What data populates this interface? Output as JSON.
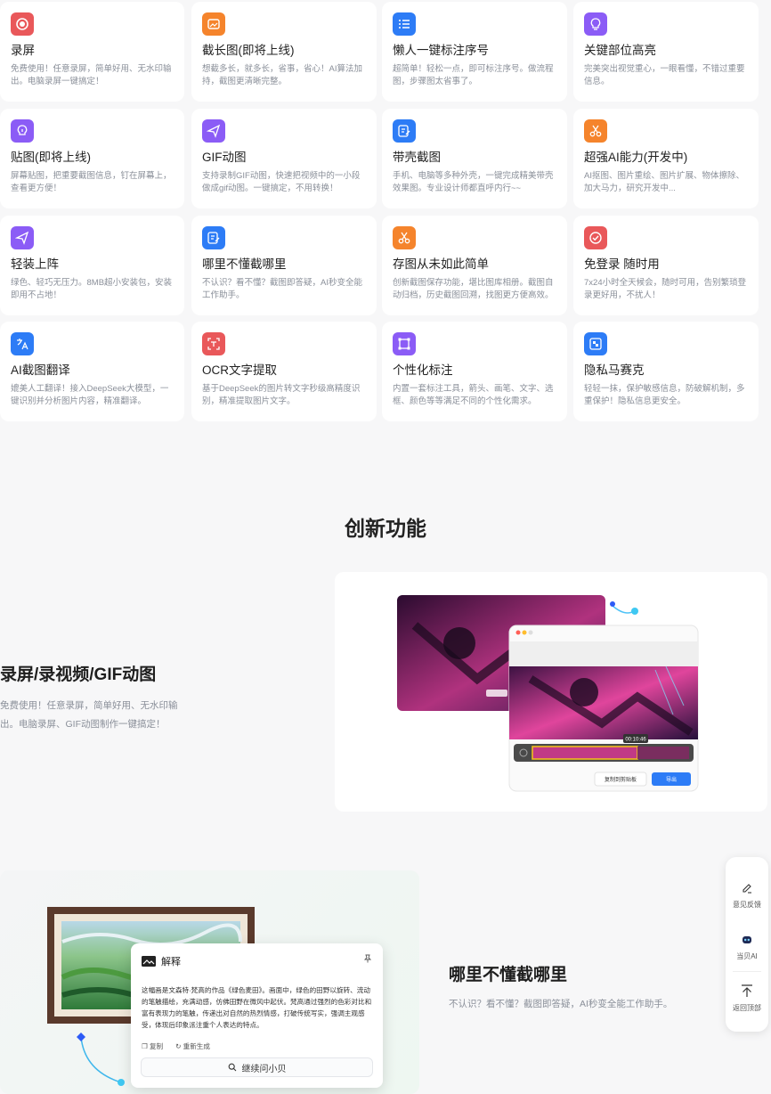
{
  "features": [
    {
      "title": "录屏",
      "desc": "免费使用！任意录屏，简单好用、无水印输出。电脑录屏一键搞定！",
      "icon": "record-icon",
      "color": "#e9585a"
    },
    {
      "title": "截长图(即将上线)",
      "desc": "想截多长，就多长，省事，省心！AI算法加持，截图更清晰完整。",
      "icon": "long-image-icon",
      "color": "#f5842c"
    },
    {
      "title": "懒人一键标注序号",
      "desc": "超简单！轻松一点，即可标注序号。做流程图，步骤图太省事了。",
      "icon": "list-number-icon",
      "color": "#2d7cf6"
    },
    {
      "title": "关键部位高亮",
      "desc": "完美突出视觉重心，一眼看懂，不错过重要信息。",
      "icon": "bulb-icon",
      "color": "#8b5cf6"
    },
    {
      "title": "贴图(即将上线)",
      "desc": "屏幕贴图，把重要截图信息，钉在屏幕上，查看更方便！",
      "icon": "pin-bulb-icon",
      "color": "#8b5cf6"
    },
    {
      "title": "GIF动图",
      "desc": "支持录制GIF动图，快速把视频中的一小段做成gif动图。一键搞定，不用转换！",
      "icon": "send-icon",
      "color": "#8b5cf6"
    },
    {
      "title": "带壳截图",
      "desc": "手机、电脑等多种外壳，一键完成精美带壳效果图。专业设计师都直呼内行~~",
      "icon": "edit-frame-icon",
      "color": "#2d7cf6"
    },
    {
      "title": "超强AI能力(开发中)",
      "desc": "AI抠图、图片重绘、图片扩展、物体擦除、加大马力，研究开发中...",
      "icon": "scissors-icon",
      "color": "#f5842c"
    },
    {
      "title": "轻装上阵",
      "desc": "绿色、轻巧无压力。8MB超小安装包，安装即用不占地！",
      "icon": "send-icon",
      "color": "#8b5cf6"
    },
    {
      "title": "哪里不懂截哪里",
      "desc": "不认识？看不懂？截图即答疑，AI秒变全能工作助手。",
      "icon": "edit-frame-icon",
      "color": "#2d7cf6"
    },
    {
      "title": "存图从未如此简单",
      "desc": "创新截图保存功能，堪比图库相册。截图自动归档，历史截图回溯，找图更方便高效。",
      "icon": "scissors-icon",
      "color": "#f5842c"
    },
    {
      "title": "免登录 随时用",
      "desc": "7x24小时全天候会，随时可用，告别繁琐登录更好用，不扰人！",
      "icon": "check-circle-icon",
      "color": "#e9585a"
    },
    {
      "title": "AI截图翻译",
      "desc": "媲美人工翻译！接入DeepSeek大模型，一键识别并分析图片内容，精准翻译。",
      "icon": "translate-icon",
      "color": "#2d7cf6"
    },
    {
      "title": "OCR文字提取",
      "desc": "基于DeepSeek的图片转文字秒级高精度识别，精准提取图片文字。",
      "icon": "ocr-icon",
      "color": "#e9585a"
    },
    {
      "title": "个性化标注",
      "desc": "内置一套标注工具，箭头、画笔、文字、选框、颜色等等满足不同的个性化需求。",
      "icon": "frame-select-icon",
      "color": "#8b5cf6"
    },
    {
      "title": "隐私马赛克",
      "desc": "轻轻一抹，保护敏感信息，防破解机制，多重保护！隐私信息更安全。",
      "icon": "mosaic-icon",
      "color": "#2d7cf6"
    }
  ],
  "section_title": "创新功能",
  "feature_record": {
    "title": "录屏/录视频/GIF动图",
    "desc": "免费使用！任意录屏，简单好用、无水印输出。电脑录屏、GIF动图制作一键搞定！",
    "video_time": "00:10:46",
    "btn_copy": "复制到剪贴板",
    "btn_export": "导出"
  },
  "feature_ask": {
    "title": "哪里不懂截哪里",
    "desc": "不认识？看不懂？截图即答疑，AI秒变全能工作助手。",
    "chat_header": "解释",
    "chat_text": "这幅画是文森特·梵高的作品《绿色麦田》。画面中，绿色的田野以旋转、流动的笔触描绘，充满动感，仿佛田野在微风中起伏。梵高通过强烈的色彩对比和富有表现力的笔触，传递出对自然的热烈情感，打破传统写实，强调主观感受，体现后印象派注重个人表达的特点。",
    "copy_label": "复制",
    "regen_label": "重新生成",
    "ask_label": "继续问小贝"
  },
  "float_bar": {
    "feedback": "意见反馈",
    "assistant": "当贝AI",
    "top": "返回顶部"
  }
}
